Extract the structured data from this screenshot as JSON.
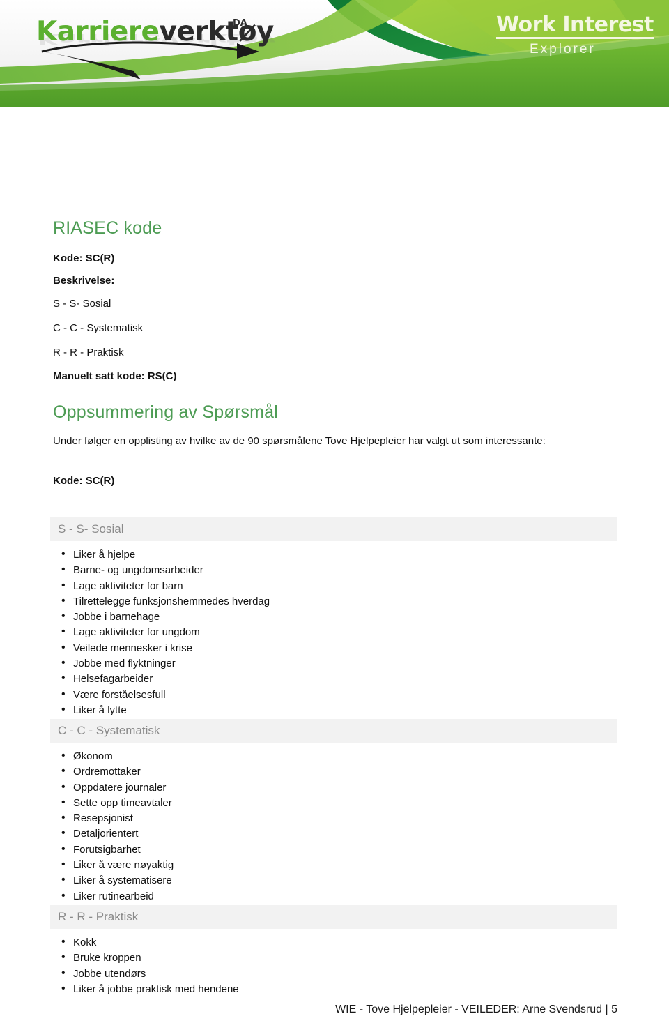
{
  "header": {
    "logo": {
      "part_green": "Karriere",
      "part_dark": "verktøy",
      "superscript": "DA"
    },
    "product_title": "Work Interest",
    "product_subtitle": "Explorer"
  },
  "riasec": {
    "heading": "RIASEC kode",
    "code_line": "Kode: SC(R)",
    "description_label": "Beskrivelse:",
    "descriptions": [
      "S - S- Sosial",
      "C - C - Systematisk",
      "R - R - Praktisk"
    ],
    "manual_code_line": "Manuelt satt kode: RS(C)"
  },
  "summary": {
    "heading": "Oppsummering av Spørsmål",
    "intro": "Under følger en opplisting av hvilke av de 90 spørsmålene Tove Hjelpepleier har valgt ut som interessante:",
    "code_line": "Kode: SC(R)",
    "categories": [
      {
        "title": "S - S- Sosial",
        "items": [
          "Liker å hjelpe",
          "Barne- og ungdomsarbeider",
          "Lage aktiviteter for barn",
          "Tilrettelegge funksjonshemmedes hverdag",
          "Jobbe i barnehage",
          "Lage aktiviteter for ungdom",
          "Veilede mennesker i krise",
          "Jobbe med flyktninger",
          "Helsefagarbeider",
          "Være forståelsesfull",
          "Liker å lytte"
        ]
      },
      {
        "title": "C - C - Systematisk",
        "items": [
          "Økonom",
          "Ordremottaker",
          "Oppdatere journaler",
          "Sette opp timeavtaler",
          "Resepsjonist",
          "Detaljorientert",
          "Forutsigbarhet",
          "Liker å være nøyaktig",
          "Liker å systematisere",
          "Liker rutinearbeid"
        ]
      },
      {
        "title": "R - R - Praktisk",
        "items": [
          "Kokk",
          "Bruke kroppen",
          "Jobbe utendørs",
          "Liker å jobbe praktisk med hendene"
        ]
      }
    ]
  },
  "footer": {
    "text": "WIE - Tove Hjelpepleier - VEILEDER: Arne Svendsrud | 5"
  },
  "colors": {
    "heading_green": "#4d9c54",
    "logo_green": "#5bb030",
    "banner_dark_green": "#1f8a3b",
    "banner_mid_green": "#6cb92e",
    "banner_light_green": "#9bcb3b",
    "section_bar_bg": "#f2f2f2",
    "section_bar_text": "#8a8a8a"
  }
}
